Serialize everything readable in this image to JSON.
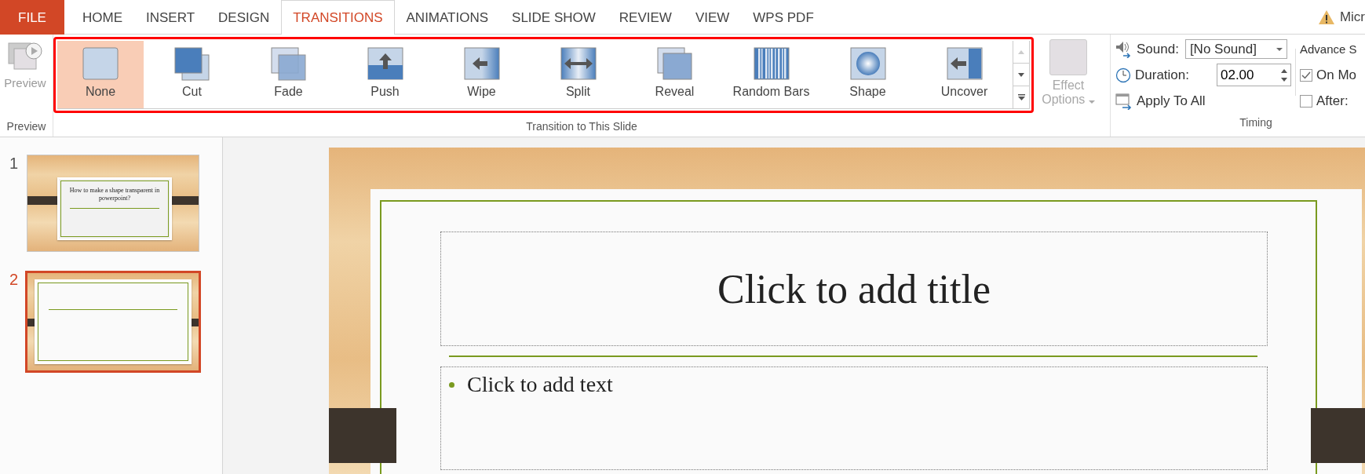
{
  "tabs": [
    {
      "label": "FILE",
      "kind": "file",
      "selected": false
    },
    {
      "label": "HOME",
      "kind": "tab",
      "selected": false
    },
    {
      "label": "INSERT",
      "kind": "tab",
      "selected": false
    },
    {
      "label": "DESIGN",
      "kind": "tab",
      "selected": false
    },
    {
      "label": "TRANSITIONS",
      "kind": "tab",
      "selected": true
    },
    {
      "label": "ANIMATIONS",
      "kind": "tab",
      "selected": false
    },
    {
      "label": "SLIDE SHOW",
      "kind": "tab",
      "selected": false
    },
    {
      "label": "REVIEW",
      "kind": "tab",
      "selected": false
    },
    {
      "label": "VIEW",
      "kind": "tab",
      "selected": false
    },
    {
      "label": "WPS PDF",
      "kind": "tab",
      "selected": false
    }
  ],
  "account": {
    "label": "Micr"
  },
  "preview": {
    "button": "Preview",
    "group": "Preview"
  },
  "transitions": {
    "group": "Transition to This Slide",
    "items": [
      {
        "label": "None",
        "kind": "none",
        "selected": true
      },
      {
        "label": "Cut",
        "kind": "cut",
        "selected": false
      },
      {
        "label": "Fade",
        "kind": "fade",
        "selected": false
      },
      {
        "label": "Push",
        "kind": "push",
        "selected": false
      },
      {
        "label": "Wipe",
        "kind": "wipe",
        "selected": false
      },
      {
        "label": "Split",
        "kind": "split",
        "selected": false
      },
      {
        "label": "Reveal",
        "kind": "reveal",
        "selected": false
      },
      {
        "label": "Random Bars",
        "kind": "bars",
        "selected": false
      },
      {
        "label": "Shape",
        "kind": "shape",
        "selected": false
      },
      {
        "label": "Uncover",
        "kind": "uncover",
        "selected": false
      }
    ]
  },
  "effect_options": {
    "label": "Effect Options",
    "disabled": true
  },
  "timing": {
    "group": "Timing",
    "sound_label": "Sound:",
    "sound_value": "[No Sound]",
    "duration_label": "Duration:",
    "duration_value": "02.00",
    "apply_all": "Apply To All"
  },
  "advance": {
    "title": "Advance S",
    "options": [
      {
        "label": "On Mo",
        "checked": true
      },
      {
        "label": "After:",
        "checked": false
      }
    ]
  },
  "slides": [
    {
      "number": "1",
      "selected": false,
      "title": "How to make a shape transparent in powerpoint?"
    },
    {
      "number": "2",
      "selected": true
    }
  ],
  "slide": {
    "title_placeholder": "Click to add title",
    "text_placeholder": "Click to add text"
  }
}
